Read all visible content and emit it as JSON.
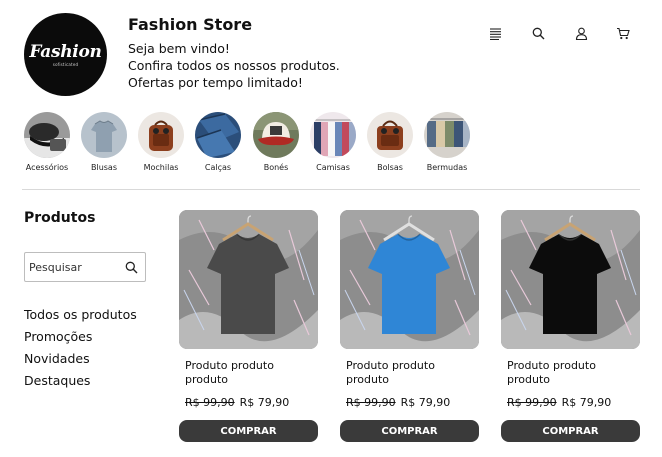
{
  "brand": {
    "logo_text": "Fashion",
    "logo_subtext": "sofisticated",
    "store_name": "Fashion Store",
    "welcome_lines": [
      "Seja bem vindo!",
      "Confira todos os nossos produtos.",
      "Ofertas por tempo limitado!"
    ]
  },
  "header_icons": [
    "menu-icon",
    "search-icon",
    "user-icon",
    "cart-icon"
  ],
  "categories": [
    {
      "label": "Acessórios",
      "icon": "cap-and-bag-photo"
    },
    {
      "label": "Blusas",
      "icon": "shirt-photo"
    },
    {
      "label": "Mochilas",
      "icon": "backpack-photo"
    },
    {
      "label": "Calças",
      "icon": "jeans-photo"
    },
    {
      "label": "Bonés",
      "icon": "cap-photo"
    },
    {
      "label": "Camisas",
      "icon": "hanging-shirts-photo"
    },
    {
      "label": "Bolsas",
      "icon": "bag-photo"
    },
    {
      "label": "Bermudas",
      "icon": "shorts-photo"
    }
  ],
  "sidebar": {
    "title": "Produtos",
    "search_placeholder": "Pesquisar",
    "links": [
      "Todos os produtos",
      "Promoções",
      "Novidades",
      "Destaques"
    ]
  },
  "products": [
    {
      "name": "Produto produto produto",
      "old_price": "R$ 99,90",
      "price": "R$ 79,90",
      "buy_label": "COMPRAR",
      "shirt_color": "#4a4a4a"
    },
    {
      "name": "Produto produto produto",
      "old_price": "R$ 99,90",
      "price": "R$ 79,90",
      "buy_label": "COMPRAR",
      "shirt_color": "#2f86d6"
    },
    {
      "name": "Produto produto produto",
      "old_price": "R$ 99,90",
      "price": "R$ 79,90",
      "buy_label": "COMPRAR",
      "shirt_color": "#0c0c0c"
    }
  ],
  "colors": {
    "button_bg": "#3a3a3a",
    "logo_bg": "#0b0b0b"
  }
}
